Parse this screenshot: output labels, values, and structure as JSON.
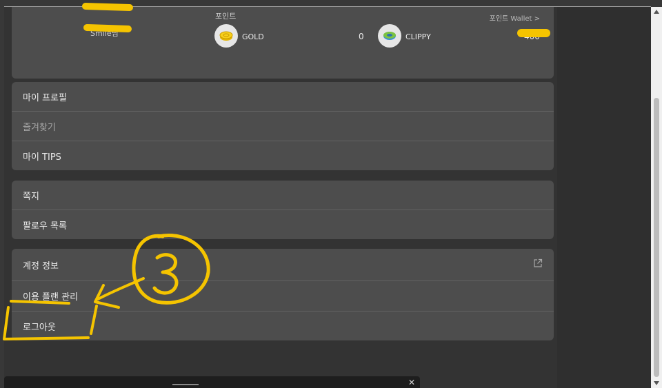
{
  "points": {
    "title": "포인트",
    "wallet_link": "포인트 Wallet  >",
    "user_name": "Smile님",
    "gold": {
      "label": "GOLD",
      "value": "0"
    },
    "clippy": {
      "label": "CLIPPY",
      "value": "400"
    }
  },
  "menu_group_1": [
    {
      "label": "마이 프로필"
    },
    {
      "label": "즐겨찾기"
    },
    {
      "label": "마이 TIPS"
    }
  ],
  "menu_group_2": [
    {
      "label": "쪽지"
    },
    {
      "label": "팔로우 목록"
    }
  ],
  "menu_group_3": [
    {
      "label": "계정 정보"
    },
    {
      "label": "이용 플랜 관리"
    },
    {
      "label": "로그아웃"
    }
  ],
  "icons": {
    "gold": "gold-coin-icon",
    "clippy": "clippy-coin-icon",
    "external": "external-link-icon",
    "close": "close-icon"
  },
  "colors": {
    "annotation": "#f5c400",
    "card_bg": "#4d4d4d",
    "page_bg": "#333333"
  }
}
